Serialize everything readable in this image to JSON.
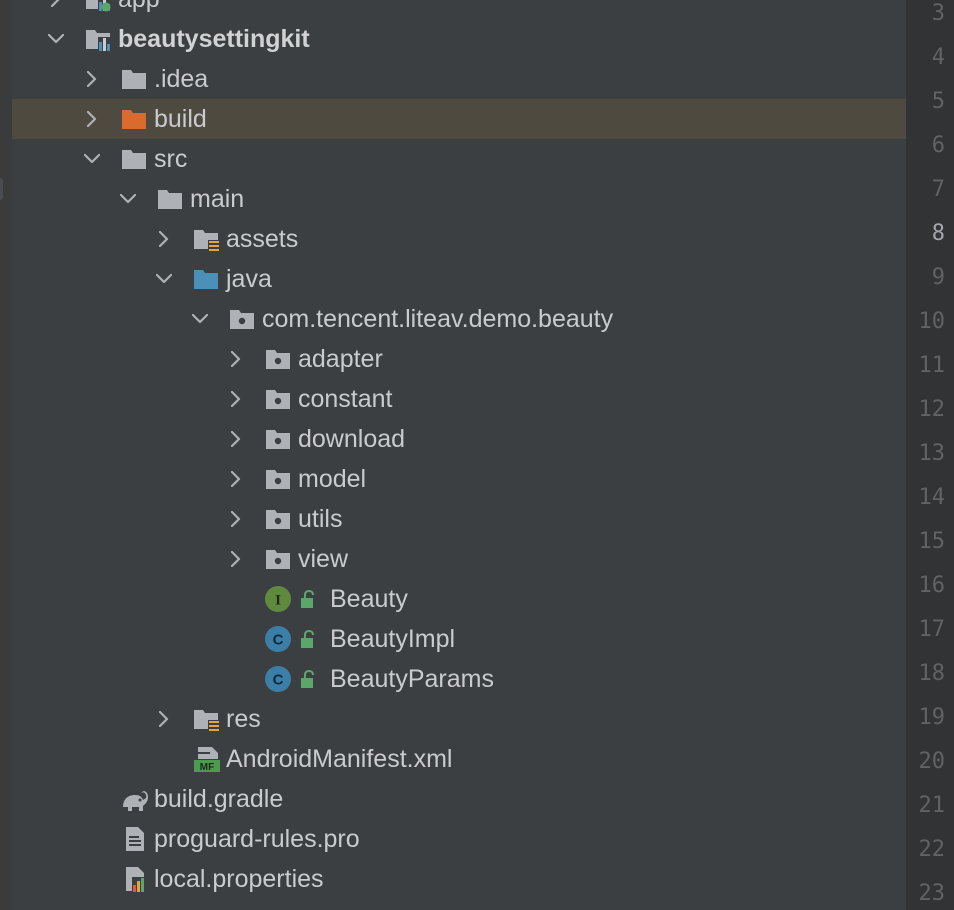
{
  "colors": {
    "background": "#3c3f41",
    "selection": "#4e4a40",
    "gutter": "#313335",
    "text": "#c9cbce",
    "folder_grey": "#aeb1b5",
    "folder_excluded": "#d96b2f",
    "folder_source": "#4a90b8",
    "interface_badge": "#5f8a3e",
    "class_badge": "#3b7fa8",
    "line_number": "#606366"
  },
  "tree": [
    {
      "label": "app",
      "depth": 1,
      "chevron": "right",
      "icon": "module-folder-icon"
    },
    {
      "label": "beautysettingkit",
      "depth": 1,
      "chevron": "down",
      "icon": "module-folder-icon",
      "bold": true
    },
    {
      "label": ".idea",
      "depth": 2,
      "chevron": "right",
      "icon": "folder-icon"
    },
    {
      "label": "build",
      "depth": 2,
      "chevron": "right",
      "icon": "excluded-folder-icon",
      "selected": true
    },
    {
      "label": "src",
      "depth": 2,
      "chevron": "down",
      "icon": "folder-icon"
    },
    {
      "label": "main",
      "depth": 3,
      "chevron": "down",
      "icon": "folder-icon"
    },
    {
      "label": "assets",
      "depth": 4,
      "chevron": "right",
      "icon": "resource-folder-icon"
    },
    {
      "label": "java",
      "depth": 4,
      "chevron": "down",
      "icon": "source-folder-icon"
    },
    {
      "label": "com.tencent.liteav.demo.beauty",
      "depth": 5,
      "chevron": "down",
      "icon": "package-icon"
    },
    {
      "label": "adapter",
      "depth": 6,
      "chevron": "right",
      "icon": "package-icon"
    },
    {
      "label": "constant",
      "depth": 6,
      "chevron": "right",
      "icon": "package-icon"
    },
    {
      "label": "download",
      "depth": 6,
      "chevron": "right",
      "icon": "package-icon"
    },
    {
      "label": "model",
      "depth": 6,
      "chevron": "right",
      "icon": "package-icon"
    },
    {
      "label": "utils",
      "depth": 6,
      "chevron": "right",
      "icon": "package-icon"
    },
    {
      "label": "view",
      "depth": 6,
      "chevron": "right",
      "icon": "package-icon"
    },
    {
      "label": "Beauty",
      "depth": 6,
      "chevron": "none",
      "icon": "interface-icon",
      "badge": "I",
      "lock": true
    },
    {
      "label": "BeautyImpl",
      "depth": 6,
      "chevron": "none",
      "icon": "class-icon",
      "badge": "C",
      "lock": true
    },
    {
      "label": "BeautyParams",
      "depth": 6,
      "chevron": "none",
      "icon": "class-icon",
      "badge": "C",
      "lock": true
    },
    {
      "label": "res",
      "depth": 4,
      "chevron": "right",
      "icon": "resource-folder-icon"
    },
    {
      "label": "AndroidManifest.xml",
      "depth": 4,
      "chevron": "none",
      "icon": "manifest-icon",
      "badge": "MF"
    },
    {
      "label": "build.gradle",
      "depth": 2,
      "chevron": "none",
      "icon": "gradle-icon"
    },
    {
      "label": "proguard-rules.pro",
      "depth": 2,
      "chevron": "none",
      "icon": "text-file-icon"
    },
    {
      "label": "local.properties",
      "depth": 2,
      "chevron": "none",
      "icon": "properties-file-icon"
    },
    {
      "label": "",
      "depth": 1,
      "chevron": "right",
      "icon": "folder-icon"
    }
  ],
  "gutter": {
    "lines": [
      "3",
      "4",
      "5",
      "6",
      "7",
      "8",
      "9",
      "10",
      "11",
      "12",
      "13",
      "14",
      "15",
      "16",
      "17",
      "18",
      "19",
      "20",
      "21",
      "22",
      "23"
    ],
    "current": "8"
  }
}
